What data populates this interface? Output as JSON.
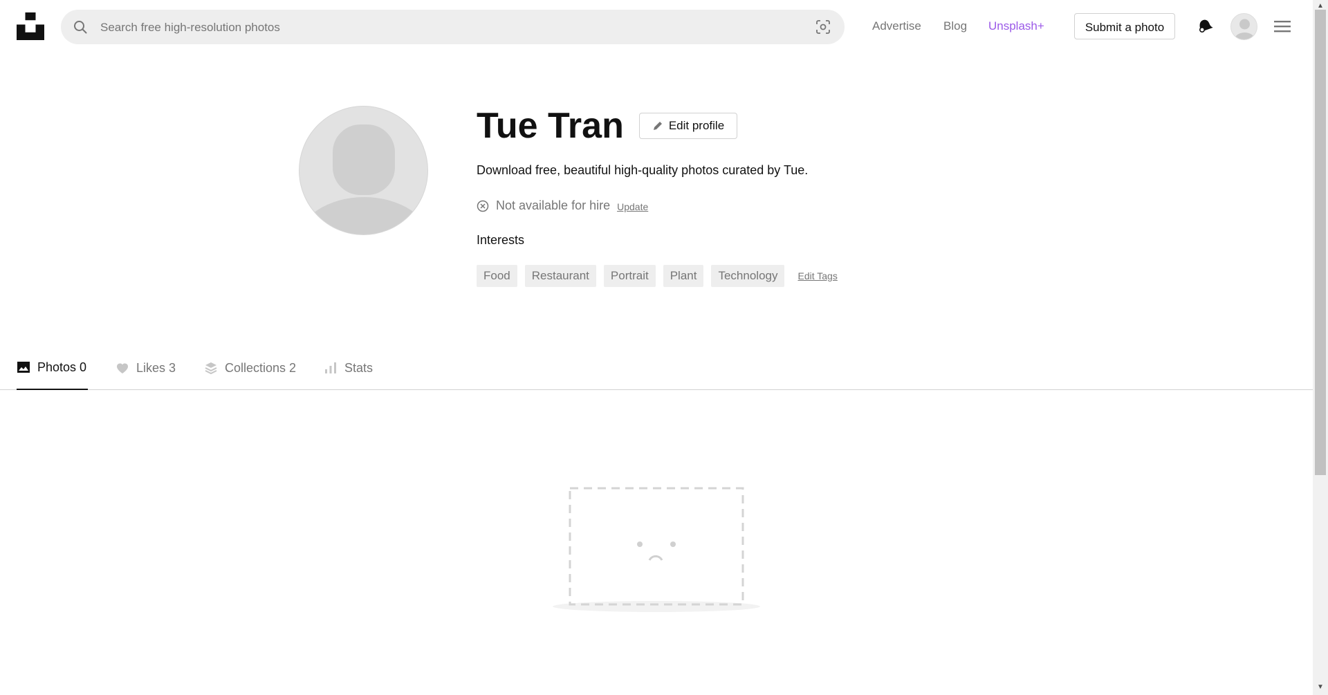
{
  "header": {
    "search_placeholder": "Search free high-resolution photos",
    "nav": {
      "advertise": "Advertise",
      "blog": "Blog",
      "unsplash_plus": "Unsplash+"
    },
    "submit_label": "Submit a photo"
  },
  "profile": {
    "name": "Tue Tran",
    "edit_label": "Edit profile",
    "bio": "Download free, beautiful high-quality photos curated by Tue.",
    "hire_status": "Not available for hire",
    "hire_update": "Update",
    "interests_title": "Interests",
    "tags": [
      "Food",
      "Restaurant",
      "Portrait",
      "Plant",
      "Technology"
    ],
    "edit_tags": "Edit Tags"
  },
  "tabs": [
    {
      "label": "Photos 0",
      "icon": "image-icon",
      "active": true
    },
    {
      "label": "Likes 3",
      "icon": "heart-icon",
      "active": false
    },
    {
      "label": "Collections 2",
      "icon": "collections-icon",
      "active": false
    },
    {
      "label": "Stats",
      "icon": "stats-icon",
      "active": false
    }
  ],
  "colors": {
    "accent_plus": "#9b59e8",
    "text_muted": "#767676",
    "tag_bg": "#eeeeee"
  }
}
